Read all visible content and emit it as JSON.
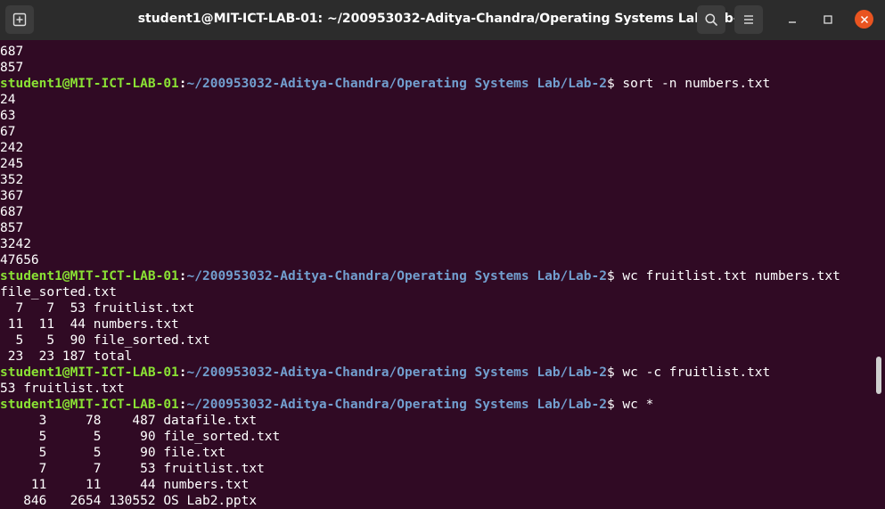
{
  "window": {
    "title": "student1@MIT-ICT-LAB-01: ~/200953032-Aditya-Chandra/Operating Systems Lab/Lab-2",
    "icons": {
      "new_tab": "new-tab-icon",
      "search": "search-icon",
      "menu": "hamburger-menu-icon",
      "minimize": "minimize-icon",
      "maximize": "maximize-icon",
      "close": "close-icon"
    },
    "colors": {
      "background": "#300a24",
      "titlebar": "#2c2c2c",
      "prompt_user": "#8ae234",
      "prompt_path": "#729fcf",
      "close_button": "#e95420"
    }
  },
  "terminal": {
    "lines": [
      {
        "type": "output",
        "text": "687"
      },
      {
        "type": "output",
        "text": "857"
      },
      {
        "type": "prompt",
        "user": "student1@MIT-ICT-LAB-01",
        "sep": ":",
        "path": "~/200953032-Aditya-Chandra/Operating Systems Lab/Lab-2",
        "cmd": "$ sort -n numbers.txt"
      },
      {
        "type": "output",
        "text": "24"
      },
      {
        "type": "output",
        "text": "63"
      },
      {
        "type": "output",
        "text": "67"
      },
      {
        "type": "output",
        "text": "242"
      },
      {
        "type": "output",
        "text": "245"
      },
      {
        "type": "output",
        "text": "352"
      },
      {
        "type": "output",
        "text": "367"
      },
      {
        "type": "output",
        "text": "687"
      },
      {
        "type": "output",
        "text": "857"
      },
      {
        "type": "output",
        "text": "3242"
      },
      {
        "type": "output",
        "text": "47656"
      },
      {
        "type": "prompt",
        "user": "student1@MIT-ICT-LAB-01",
        "sep": ":",
        "path": "~/200953032-Aditya-Chandra/Operating Systems Lab/Lab-2",
        "cmd": "$ wc fruitlist.txt numbers.txt"
      },
      {
        "type": "output",
        "text": "file_sorted.txt"
      },
      {
        "type": "output",
        "text": "  7   7  53 fruitlist.txt"
      },
      {
        "type": "output",
        "text": " 11  11  44 numbers.txt"
      },
      {
        "type": "output",
        "text": "  5   5  90 file_sorted.txt"
      },
      {
        "type": "output",
        "text": " 23  23 187 total"
      },
      {
        "type": "prompt",
        "user": "student1@MIT-ICT-LAB-01",
        "sep": ":",
        "path": "~/200953032-Aditya-Chandra/Operating Systems Lab/Lab-2",
        "cmd": "$ wc -c fruitlist.txt"
      },
      {
        "type": "output",
        "text": "53 fruitlist.txt"
      },
      {
        "type": "prompt",
        "user": "student1@MIT-ICT-LAB-01",
        "sep": ":",
        "path": "~/200953032-Aditya-Chandra/Operating Systems Lab/Lab-2",
        "cmd": "$ wc *"
      },
      {
        "type": "output",
        "text": "     3     78    487 datafile.txt"
      },
      {
        "type": "output",
        "text": "     5      5     90 file_sorted.txt"
      },
      {
        "type": "output",
        "text": "     5      5     90 file.txt"
      },
      {
        "type": "output",
        "text": "     7      7     53 fruitlist.txt"
      },
      {
        "type": "output",
        "text": "    11     11     44 numbers.txt"
      },
      {
        "type": "output",
        "text": "   846   2654 130552 OS Lab2.pptx"
      }
    ]
  }
}
